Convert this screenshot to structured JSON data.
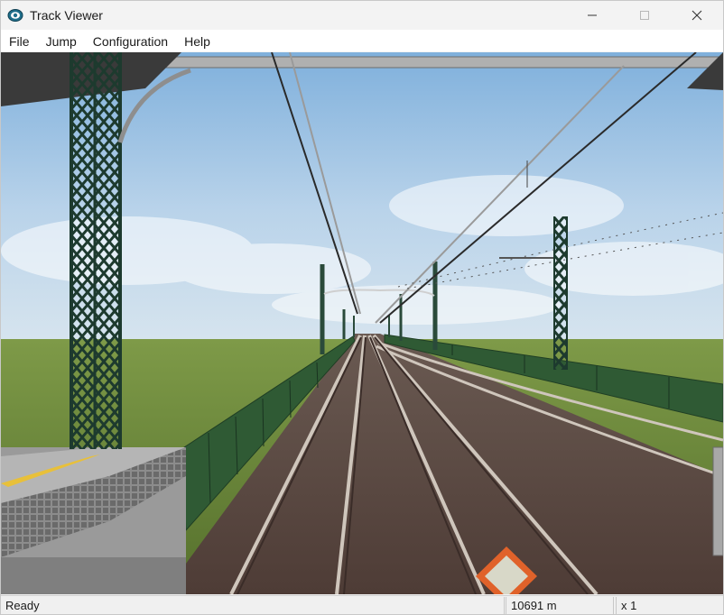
{
  "window": {
    "title": "Track Viewer",
    "icon": "track-viewer-app-icon"
  },
  "menu": {
    "items": [
      {
        "label": "File"
      },
      {
        "label": "Jump"
      },
      {
        "label": "Configuration"
      },
      {
        "label": "Help"
      }
    ]
  },
  "status": {
    "message": "Ready",
    "distance": "10691 m",
    "speed": "x 1"
  },
  "colors": {
    "sky": "#8ab4d8",
    "grass": "#6b8a3a",
    "fence": "#2f5a34",
    "ballast": "#5a4a44",
    "rail": "#d8d0c8",
    "mast": "#2a4a3a",
    "marker": "#e0622a"
  }
}
